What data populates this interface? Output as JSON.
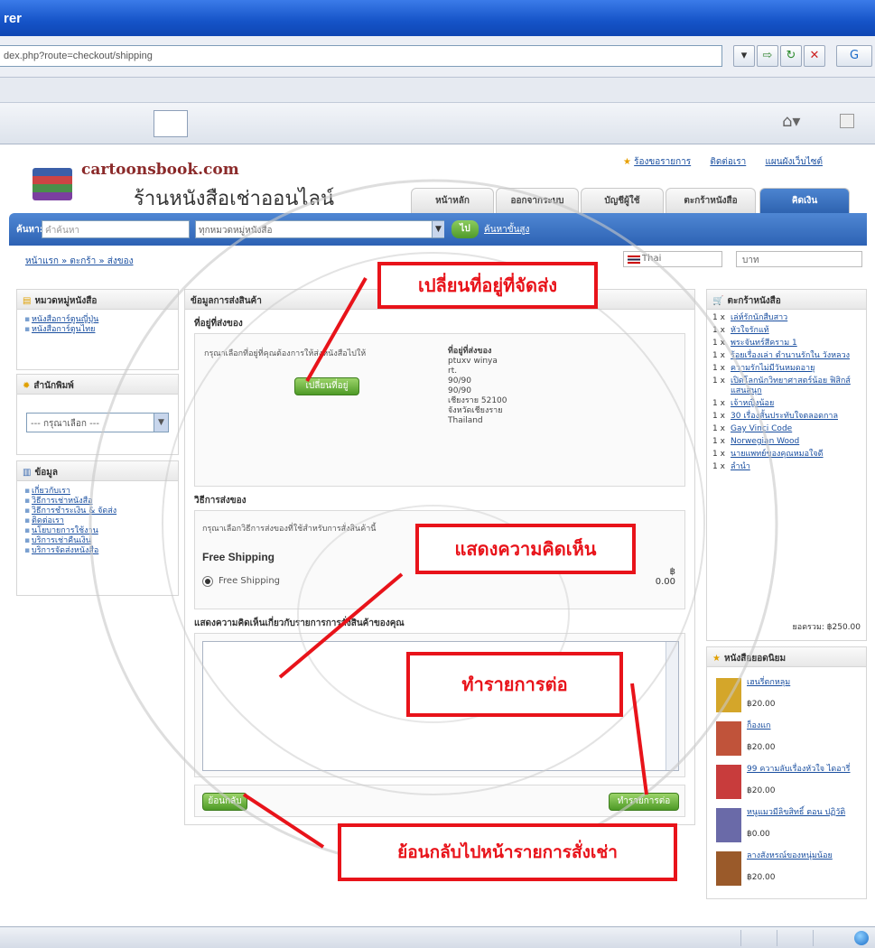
{
  "window": {
    "title": "rer"
  },
  "address": {
    "url": "dex.php?route=checkout/shipping"
  },
  "site": {
    "name": "cartoonsbook.com",
    "tagline": "ร้านหนังสือเช่าออนไลน์",
    "top_links": [
      "ร้องขอรายการ",
      "ติดต่อเรา",
      "แผนผังเว็บไซต์"
    ],
    "nav_tabs": [
      "หน้าหลัก",
      "ออกจากระบบ",
      "บัญชีผู้ใช้",
      "ตะกร้าหนังสือ",
      "คิดเงิน"
    ]
  },
  "search": {
    "label": "ค้นหา:",
    "placeholder": "คำค้นหา",
    "category": "ทุกหมวดหมู่หนังสือ",
    "go": "ไป",
    "advanced": "ค้นหาขั้นสูง"
  },
  "breadcrumb": "หน้าแรก » ตะกร้า » ส่งของ",
  "language": "Thai",
  "currency": "บาท",
  "left": {
    "categories_title": "หมวดหมู่หนังสือ",
    "categories": [
      "หนังสือการ์ตูนญี่ปุ่น",
      "หนังสือการ์ตูนไทย"
    ],
    "publishers_title": "สำนักพิมพ์",
    "publisher_select": "--- กรุณาเลือก ---",
    "info_title": "ข้อมูล",
    "info_links": [
      "เกี่ยวกับเรา",
      "วิธีการเช่าหนังสือ",
      "วิธีการชำระเงิน & จัดส่ง",
      "ติดต่อเรา",
      "นโยบายการใช้งาน",
      "บริการเช่าคืนเงิน",
      "บริการจัดส่งหนังสือ"
    ]
  },
  "checkout": {
    "heading": "ข้อมูลการส่งสินค้า",
    "address_title": "ที่อยู่ที่ส่งของ",
    "address_help": "กรุณาเลือกที่อยู่ที่คุณต้องการให้ส่งหนังสือไปให้",
    "change_address": "เปลี่ยนที่อยู่",
    "address_label": "ที่อยู่ที่ส่งของ",
    "address_lines": [
      "ptuxv winya",
      "rt.",
      "90/90",
      "90/90",
      "เชียงราย 52100",
      "จังหวัดเชียงราย",
      "Thailand"
    ],
    "method_title": "วิธีการส่งของ",
    "method_help": "กรุณาเลือกวิธีการส่งของที่ใช้สำหรับการสั่งสินค้านี้",
    "method_name": "Free Shipping",
    "method_option": "Free Shipping",
    "method_price_currency": "฿",
    "method_price": "0.00",
    "comment_title": "แสดงความคิดเห็นเกี่ยวกับรายการการสั่งสินค้าของคุณ",
    "back_button": "ย้อนกลับ",
    "continue_button": "ทำรายการต่อ"
  },
  "cart": {
    "title": "ตะกร้าหนังสือ",
    "items": [
      {
        "qty": "1 x",
        "title": "เล่ห์รักนักสืบสาว"
      },
      {
        "qty": "1 x",
        "title": "หัวใจรักแท้"
      },
      {
        "qty": "1 x",
        "title": "พระจันทร์สีคราม 1"
      },
      {
        "qty": "1 x",
        "title": "ร้อยเรื่องเล่า ตำนานรักใน วังหลวง"
      },
      {
        "qty": "1 x",
        "title": "ความรักไม่มีวันหมดอายุ"
      },
      {
        "qty": "1 x",
        "title": "เปิดโลกนักวิทยาศาสตร์น้อย ฟิสิกส์แสนสนุก"
      },
      {
        "qty": "1 x",
        "title": "เจ้าหญิงน้อย"
      },
      {
        "qty": "1 x",
        "title": "30 เรื่องสั้นประทับใจตลอดกาล"
      },
      {
        "qty": "1 x",
        "title": "Gay Vinci Code"
      },
      {
        "qty": "1 x",
        "title": "Norwegian Wood"
      },
      {
        "qty": "1 x",
        "title": "นายแพทย์ของคุณหมอใจดี"
      },
      {
        "qty": "1 x",
        "title": "ลำนำ"
      }
    ],
    "total": "ยอดรวม: ฿250.00"
  },
  "bestsellers": {
    "title": "หนังสือยอดนิยม",
    "items": [
      {
        "title": "เฮนรี่ตกหลุม",
        "price": "฿20.00",
        "color": "#d4a62a"
      },
      {
        "title": "ก็องแก",
        "price": "฿20.00",
        "color": "#c0533a"
      },
      {
        "title": "99 ความลับเรื่องหัวใจ ไดอารี่",
        "price": "฿20.00",
        "color": "#c83c3c"
      },
      {
        "title": "หนูแมวมีลิขสิทธิ์ ตอน ปฏิวัติ",
        "price": "฿0.00",
        "color": "#6a6aa8"
      },
      {
        "title": "ลางสังหรณ์ของหนุ่มน้อย",
        "price": "฿20.00",
        "color": "#9a5a2a"
      }
    ]
  },
  "annotations": {
    "change_address": "เปลี่ยนที่อยู่ที่จัดส่ง",
    "comment": "แสดงความคิดเห็น",
    "continue": "ทำรายการต่อ",
    "back": "ย้อนกลับไปหน้ารายการสั่งเช่า"
  },
  "colors": {
    "annotation_red": "#e8131a",
    "nav_blue": "#2e63b0",
    "button_green": "#4e9a26",
    "link_blue": "#1a4fa0"
  }
}
